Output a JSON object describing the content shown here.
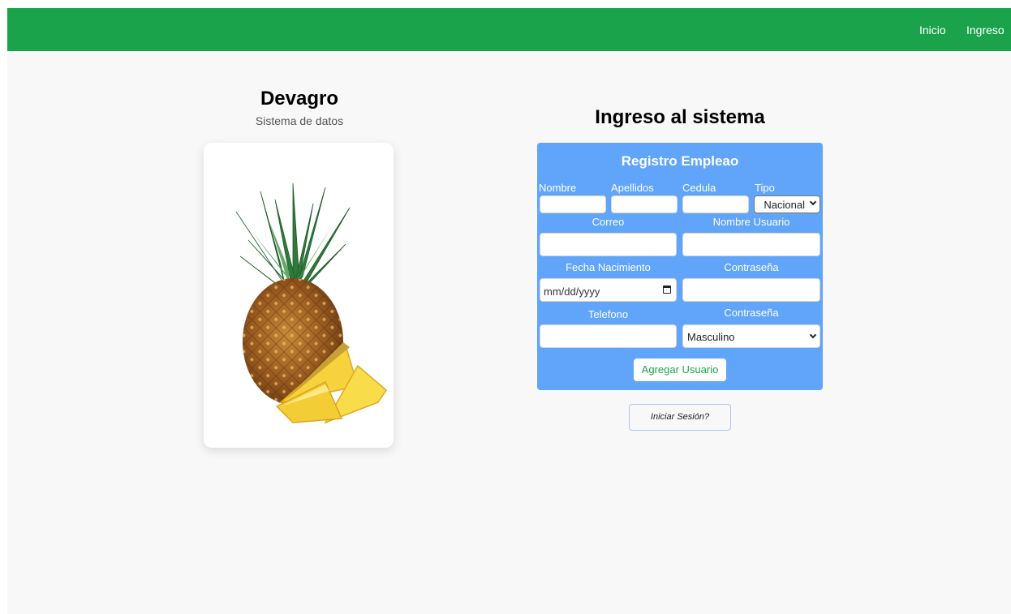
{
  "nav": {
    "links": [
      "Inicio",
      "Ingreso"
    ]
  },
  "brand": {
    "title": "Devagro",
    "subtitle": "Sistema de datos",
    "image_icon": "pineapple-image"
  },
  "form": {
    "heading": "Ingreso al sistema",
    "card_title": "Registro Empleao",
    "labels": {
      "nombre": "Nombre",
      "apellidos": "Apellidos",
      "cedula": "Cedula",
      "tipo": "Tipo",
      "correo": "Correo",
      "usuario": "Nombre Usuario",
      "fecha": "Fecha Nacimiento",
      "contrasena": "Contraseña",
      "telefono": "Telefono",
      "genero": "Contraseña"
    },
    "values": {
      "nombre": "",
      "apellidos": "",
      "cedula": "",
      "correo": "",
      "usuario": "",
      "contrasena": "",
      "telefono": ""
    },
    "tipo_selected": "Nacional",
    "date_placeholder": "mm/dd/yyyy",
    "genero_selected": "Masculino",
    "submit_label": "Agregar Usuario"
  },
  "login_link": "Iniciar Sesión?",
  "colors": {
    "navbar": "#1aa34a",
    "form_card": "#60a5fa",
    "page_bg": "#f8f8f9",
    "accent_text": "#1aa34a"
  }
}
